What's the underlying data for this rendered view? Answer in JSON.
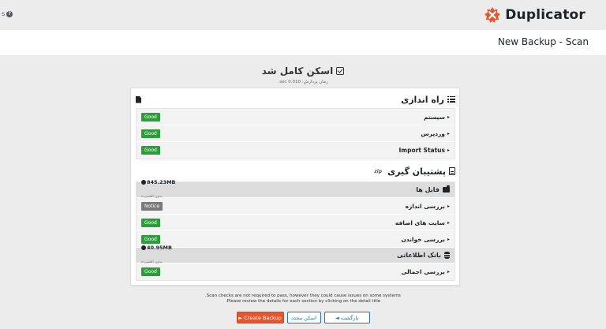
{
  "topbar": {
    "help_text": "s",
    "brand_name": "Duplicator",
    "brand_color": "#e4572e"
  },
  "header": {
    "title": "New Backup - Scan"
  },
  "scan": {
    "title": "اسکن کامل شد",
    "time": "زمان پردازش: 0.010 sec."
  },
  "setup": {
    "title": "راه اندازی",
    "rows": [
      {
        "label": "سیستم",
        "status": "Good"
      },
      {
        "label": "وردپرس",
        "status": "Good"
      },
      {
        "label": "Import Status",
        "status": "Good"
      }
    ]
  },
  "backup": {
    "title": "پشتیبان گیری",
    "zip_label": "zip",
    "files": {
      "label": "فایل ها",
      "size": "845.23MB",
      "size_sub": "بدون الفشرده",
      "rows": [
        {
          "label": "بررسی اندازه",
          "status": "Notice"
        },
        {
          "label": "سایت های اضافه",
          "status": "Good"
        },
        {
          "label": "بررسی خواندن",
          "status": "Good"
        }
      ]
    },
    "database": {
      "label": "بانک اطلاعاتی",
      "size": "40.95MB",
      "size_sub": "بدون الفشرده",
      "rows": [
        {
          "label": "بررسی اجمالی",
          "status": "Good"
        }
      ]
    }
  },
  "footer": {
    "note_line1": ".Scan checks are not required to pass, however they could cause issues on some systems",
    "note_line2": ".Please review the details for each section by clicking on the detail title",
    "create_label": "► Create Backup",
    "rescan_label": "اسکن مجدد",
    "back_label": "◄ بازگشت"
  },
  "colors": {
    "good": "#2b9e3a",
    "notice": "#7a7a7a",
    "primary_button": "#e4572e",
    "link": "#2271b1"
  }
}
